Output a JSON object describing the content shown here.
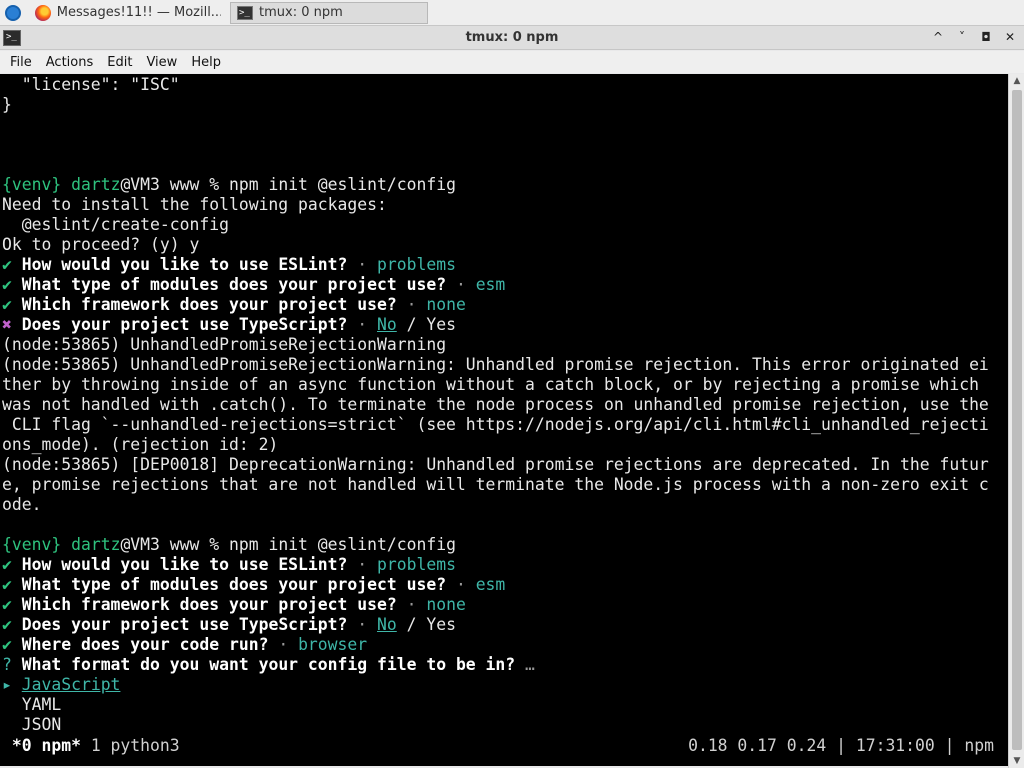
{
  "taskbar": {
    "tasks": [
      {
        "label": "Messages!11!! — Mozill..."
      },
      {
        "label": "tmux: 0 npm"
      }
    ]
  },
  "window": {
    "title": "tmux: 0 npm",
    "minimize": "^",
    "maximize": "˅",
    "restore": "◘",
    "close": "✕"
  },
  "menu": [
    "File",
    "Actions",
    "Edit",
    "View",
    "Help"
  ],
  "terminal": {
    "l1": "  \"license\": \"ISC\"",
    "l2": "}",
    "prompt_venv": "{venv}",
    "prompt_user": "dartz",
    "prompt_rest": "@VM3 www % npm init @eslint/config",
    "need": "Need to install the following packages:",
    "pkg": "  @eslint/create-config",
    "ok": "Ok to proceed? (y) y",
    "check": "✔",
    "cross": "✖",
    "q_use": "How would you like to use ESLint?",
    "a_use": "problems",
    "q_mod": "What type of modules does your project use?",
    "a_mod": "esm",
    "q_fw": "Which framework does your project use?",
    "a_fw": "none",
    "q_ts": "Does your project use TypeScript?",
    "a_no": "No",
    "a_yes": "Yes",
    "sep": " · ",
    "slash": " / ",
    "warn1": "(node:53865) UnhandledPromiseRejectionWarning",
    "warn2": "(node:53865) UnhandledPromiseRejectionWarning: Unhandled promise rejection. This error originated ei",
    "warn3": "ther by throwing inside of an async function without a catch block, or by rejecting a promise which",
    "warn4": "was not handled with .catch(). To terminate the node process on unhandled promise rejection, use the",
    "warn5": " CLI flag `--unhandled-rejections=strict` (see https://nodejs.org/api/cli.html#cli_unhandled_rejecti",
    "warn6": "ons_mode). (rejection id: 2)",
    "warn7": "(node:53865) [DEP0018] DeprecationWarning: Unhandled promise rejections are deprecated. In the futur",
    "warn8": "e, promise rejections that are not handled will terminate the Node.js process with a non-zero exit c",
    "warn9": "ode.",
    "q_run": "Where does your code run?",
    "a_run": "browser",
    "qmark": "?",
    "q_fmt": "What format do you want your config file to be in?",
    "ellipsis": " …",
    "arrow": "▸",
    "opt_js": "JavaScript",
    "opt_yaml": "YAML",
    "opt_json": "JSON"
  },
  "statusbar": {
    "win_active": " *0 npm*",
    "win_other": " 1 python3",
    "right": "0.18 0.17 0.24 | 17:31:00 | npm"
  },
  "colors": {
    "prompt_green": "#2ec27e",
    "answer_cyan": "#3fb6a8",
    "error_magenta": "#c061cb"
  }
}
